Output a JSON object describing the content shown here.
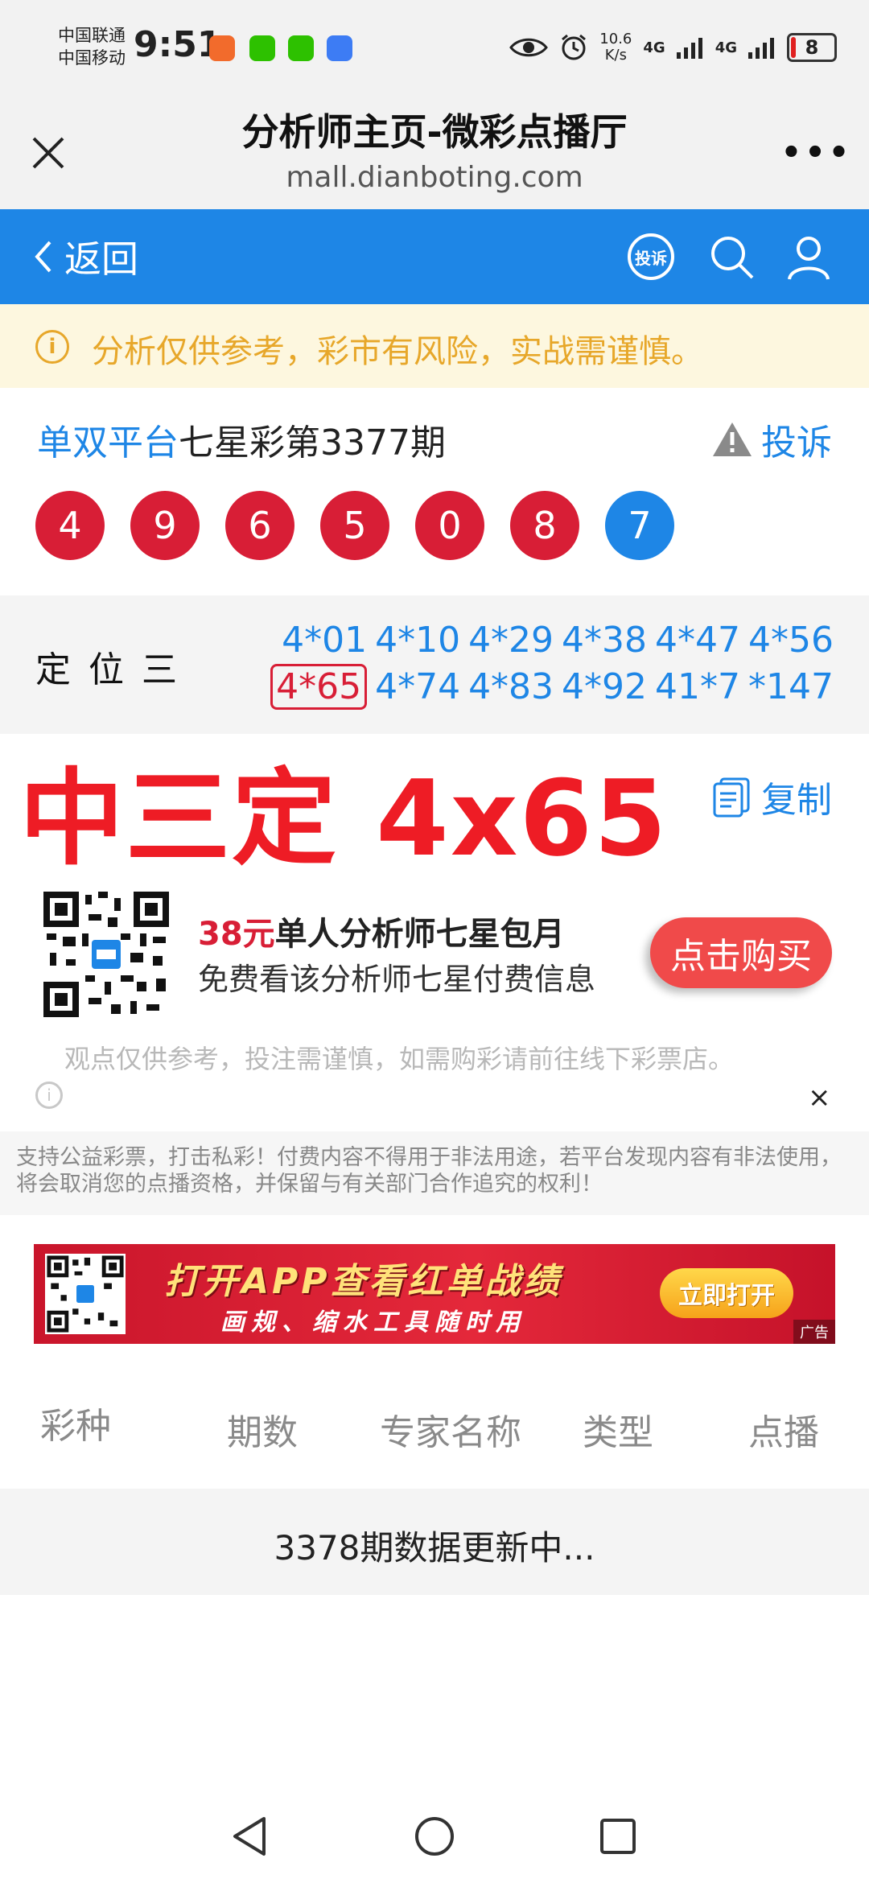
{
  "status_bar": {
    "carrier1": "中国联通",
    "carrier2": "中国移动",
    "time": "9:51",
    "net_speed": "10.6",
    "net_speed_unit": "K/s",
    "signal1": "4G",
    "signal2": "4G",
    "battery": "8"
  },
  "title_bar": {
    "title": "分析师主页-微彩点播厅",
    "url": "mall.dianboting.com",
    "more": "•••"
  },
  "nav": {
    "back_label": "返回",
    "complain_icon_label": "投诉"
  },
  "notice": {
    "text": "分析仅供参考，彩市有风险，实战需谨慎。"
  },
  "lottery": {
    "platform": "单双平台",
    "issue_title": "七星彩第3377期",
    "complain_label": "投诉",
    "balls": [
      "4",
      "9",
      "6",
      "5",
      "0",
      "8",
      "7"
    ]
  },
  "position": {
    "label": "定位三",
    "line1": [
      "4*01",
      "4*10",
      "4*29",
      "4*38",
      "4*47",
      "4*56"
    ],
    "line2_hit": "4*65",
    "line2": [
      "4*74",
      "4*83",
      "4*92",
      "41*7",
      "*147"
    ]
  },
  "result": {
    "text": "中三定 4x65",
    "copy_label": "复制"
  },
  "promo": {
    "price": "38元",
    "line1_rest": "单人分析师七星包月",
    "line2": "免费看该分析师七星付费信息",
    "buy_label": "点击购买"
  },
  "disclaimer": {
    "text": "观点仅供参考，投注需谨慎，如需购彩请前往线下彩票店。",
    "close": "×"
  },
  "legal": {
    "text": "支持公益彩票，打击私彩！付费内容不得用于非法用途，若平台发现内容有非法使用，将会取消您的点播资格，并保留与有关部门合作追究的权利！"
  },
  "ad": {
    "title": "打开APP查看红单战绩",
    "subtitle": "画规、缩水工具随时用",
    "button": "立即打开",
    "badge": "广告"
  },
  "table": {
    "headers": [
      "彩种",
      "期数",
      "专家名称",
      "类型",
      "点播"
    ],
    "update_text": "3378期数据更新中..."
  },
  "colors": {
    "brand_blue": "#1e86e6",
    "ball_red": "#d81e36",
    "result_red": "#ee1c25",
    "notice_orange": "#e7a72a"
  }
}
